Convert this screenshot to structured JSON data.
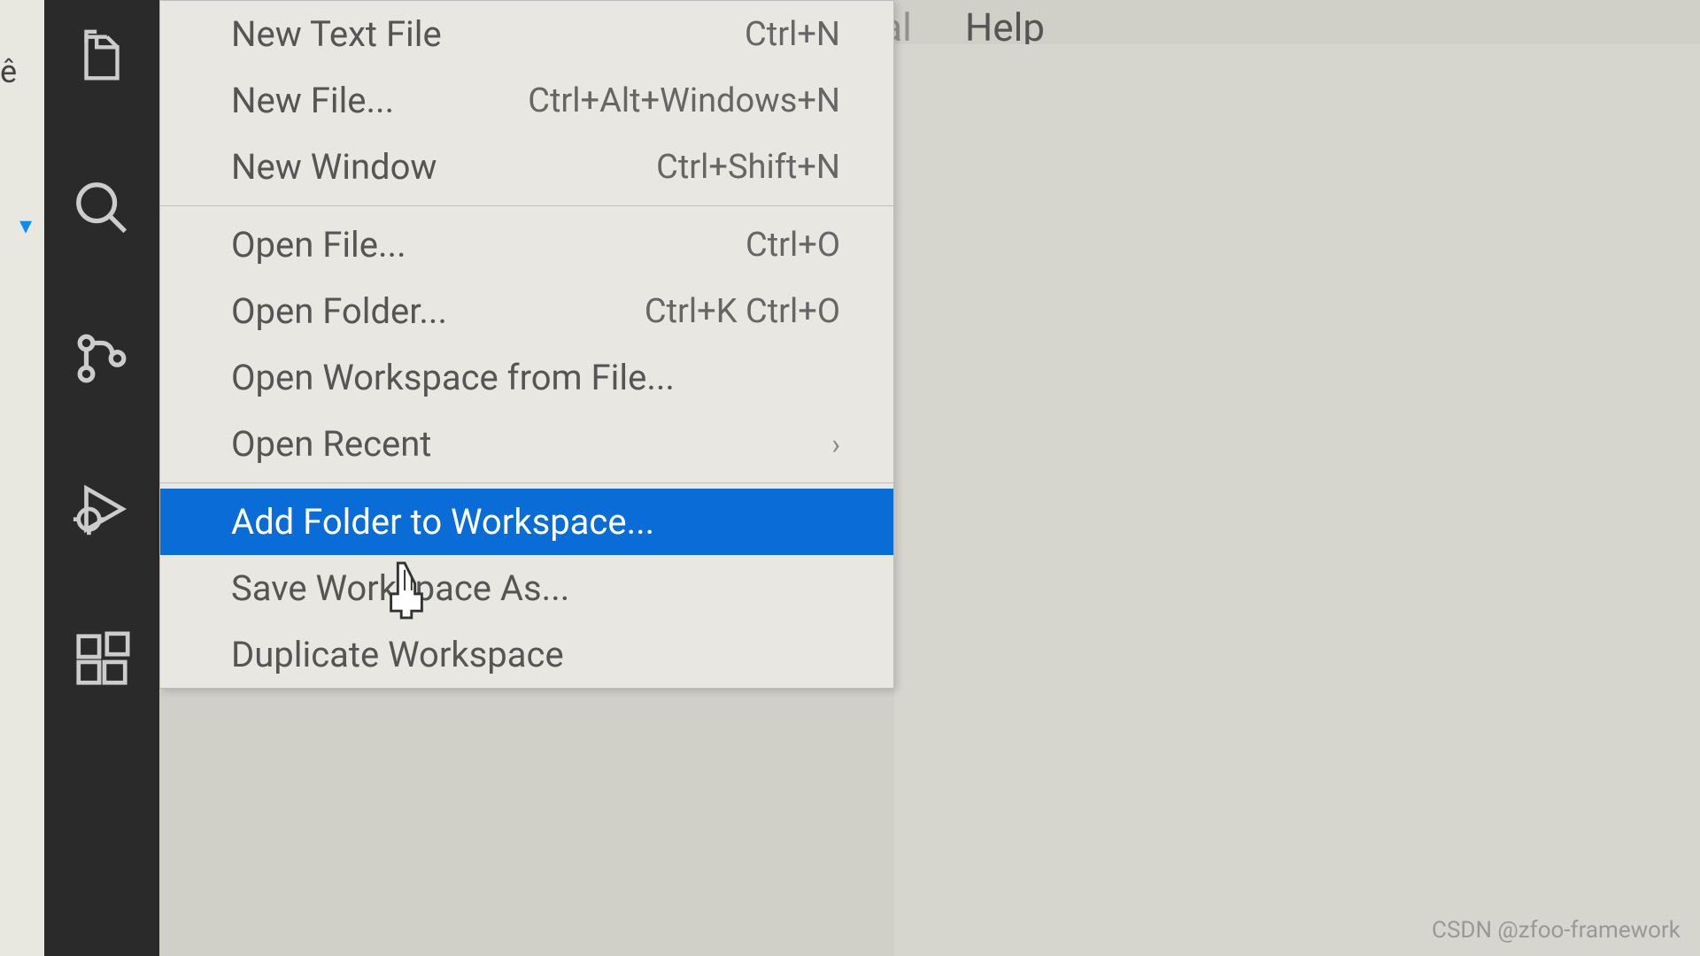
{
  "menubar": {
    "terminal": "Terminal",
    "help": "Help"
  },
  "left_edge": {
    "text": "ê",
    "marker": "▾"
  },
  "activity_bar": {
    "items": [
      "explorer",
      "search",
      "source-control",
      "run-debug",
      "extensions"
    ]
  },
  "file_menu": {
    "groups": [
      [
        {
          "label": "New Text File",
          "shortcut": "Ctrl+N"
        },
        {
          "label": "New File...",
          "shortcut": "Ctrl+Alt+Windows+N"
        },
        {
          "label": "New Window",
          "shortcut": "Ctrl+Shift+N"
        }
      ],
      [
        {
          "label": "Open File...",
          "shortcut": "Ctrl+O"
        },
        {
          "label": "Open Folder...",
          "shortcut": "Ctrl+K Ctrl+O"
        },
        {
          "label": "Open Workspace from File...",
          "shortcut": ""
        },
        {
          "label": "Open Recent",
          "shortcut": "",
          "submenu": true
        }
      ],
      [
        {
          "label": "Add Folder to Workspace...",
          "shortcut": "",
          "highlighted": true
        },
        {
          "label": "Save Workspace As...",
          "shortcut": ""
        },
        {
          "label": "Duplicate Workspace",
          "shortcut": ""
        }
      ]
    ]
  },
  "watermark": "CSDN @zfoo-framework"
}
